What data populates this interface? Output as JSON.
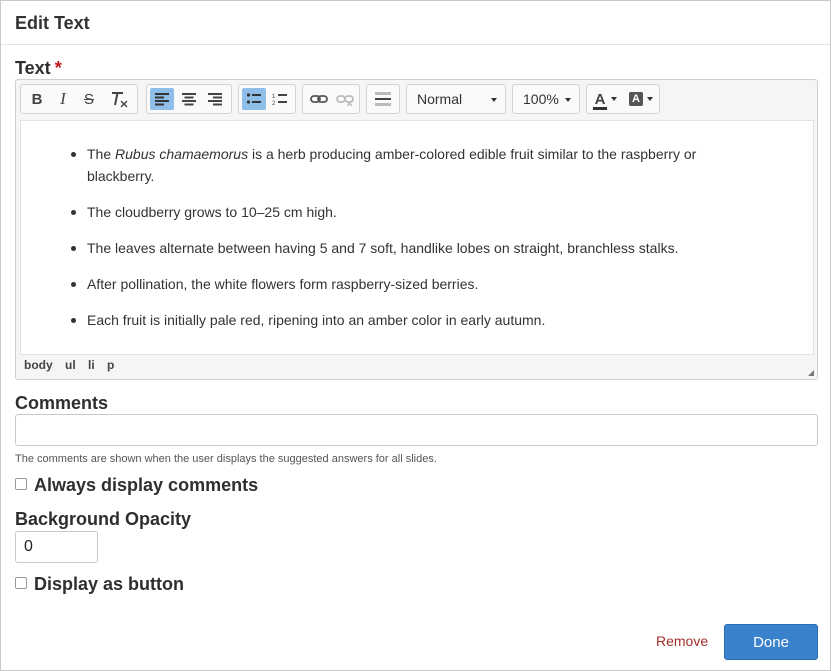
{
  "dialog": {
    "title": "Edit Text"
  },
  "text_field": {
    "label": "Text",
    "required_mark": "*",
    "toolbar": {
      "format_value": "Normal",
      "size_value": "100%",
      "icons": [
        "bold-icon",
        "italic-icon",
        "strikethrough-icon",
        "remove-format-icon",
        "align-left-icon",
        "align-center-icon",
        "align-right-icon",
        "bulleted-list-icon",
        "numbered-list-icon",
        "link-icon",
        "unlink-icon",
        "horizontal-line-icon",
        "text-color-icon",
        "background-color-icon"
      ],
      "bold": "B",
      "italic": "I",
      "strike": "S",
      "text_color": "A",
      "bg_color": "A"
    },
    "bullets": [
      {
        "before": "The ",
        "italic": "Rubus chamaemorus",
        "after": " is a herb producing amber-colored edible fruit similar to the raspberry or blackberry."
      },
      {
        "text": "The cloudberry grows to 10–25 cm high."
      },
      {
        "text": "The leaves alternate between having 5 and 7 soft, handlike lobes on straight, branchless stalks."
      },
      {
        "text": "After pollination, the white flowers form raspberry-sized berries."
      },
      {
        "text": "Each fruit is initially pale red, ripening into an amber color in early autumn."
      }
    ],
    "path": [
      "body",
      "ul",
      "li",
      "p"
    ]
  },
  "comments": {
    "label": "Comments",
    "value": "",
    "help": "The comments are shown when the user displays the suggested answers for all slides."
  },
  "always_display": {
    "label": "Always display comments",
    "checked": false
  },
  "background_opacity": {
    "label": "Background Opacity",
    "value": "0"
  },
  "display_as_button": {
    "label": "Display as button",
    "checked": false
  },
  "actions": {
    "remove": "Remove",
    "done": "Done"
  },
  "colors": {
    "accent": "#3a82cc",
    "remove": "#a12e28",
    "active_tool": "#8fbfe8",
    "required": "#c0141b"
  }
}
